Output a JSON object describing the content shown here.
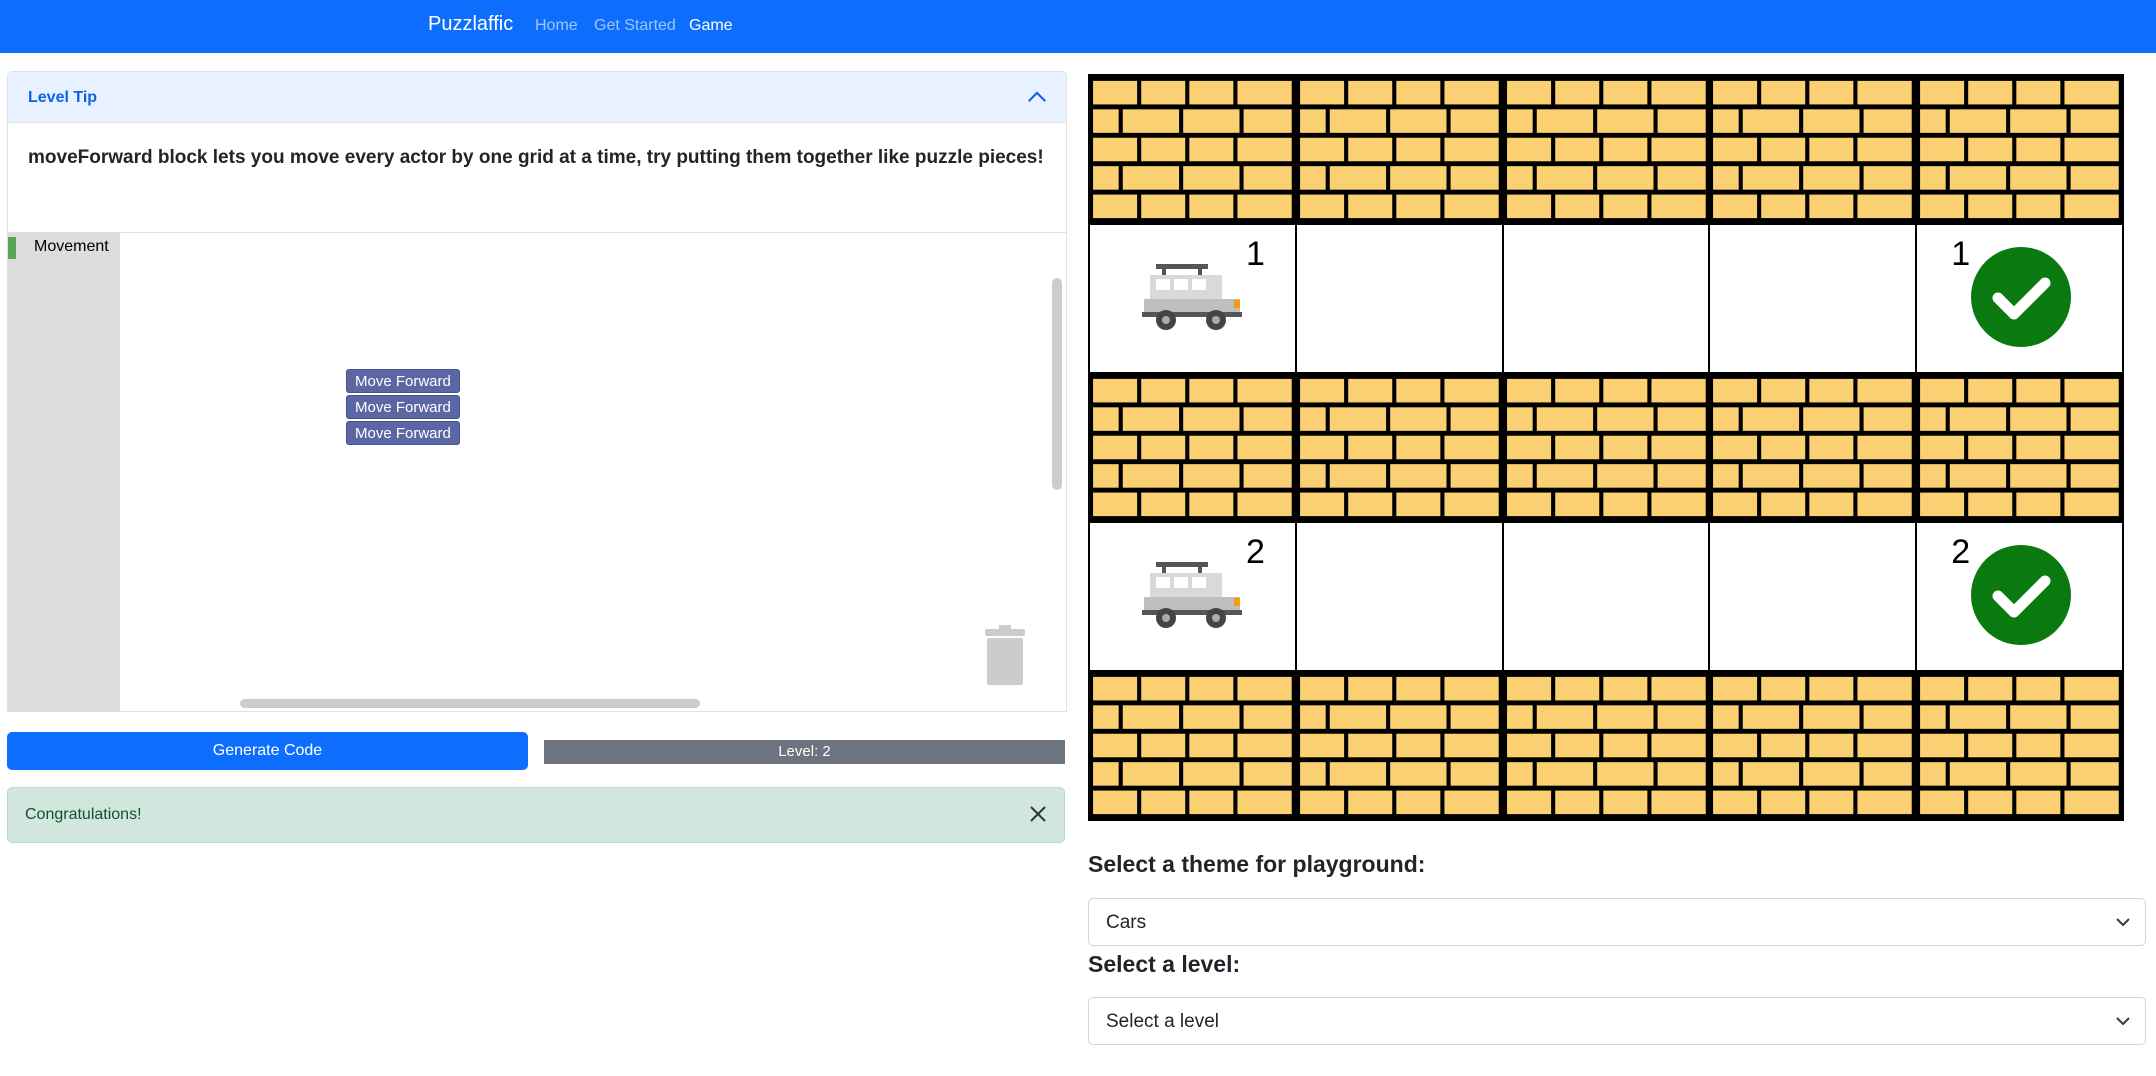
{
  "navbar": {
    "brand": "Puzzlaffic",
    "links": [
      "Home",
      "Get Started",
      "Game"
    ]
  },
  "tip": {
    "title": "Level Tip",
    "text": "moveForward block lets you move every actor by one grid at a time, try putting them together like puzzle pieces!"
  },
  "workspace": {
    "category": "Movement",
    "blocks": [
      "Move Forward",
      "Move Forward",
      "Move Forward"
    ]
  },
  "buttons": {
    "generate": "Generate Code",
    "level": "Level: 2"
  },
  "alert": {
    "text": "Congratulations!"
  },
  "grid": {
    "rows": [
      [
        "wall",
        "wall",
        "wall",
        "wall",
        "wall"
      ],
      [
        "car",
        "empty",
        "empty",
        "empty",
        "goal"
      ],
      [
        "wall",
        "wall",
        "wall",
        "wall",
        "wall"
      ],
      [
        "car",
        "empty",
        "empty",
        "empty",
        "goal"
      ],
      [
        "wall",
        "wall",
        "wall",
        "wall",
        "wall"
      ]
    ],
    "actor_labels": [
      "1",
      "2"
    ],
    "goal_labels": [
      "1",
      "2"
    ]
  },
  "colors": {
    "primary": "#0d6efd",
    "brick": "#fbd072",
    "goal": "#0a7a10",
    "block": "#5b67a5",
    "alert_bg": "#d1e7dd"
  },
  "theme_select": {
    "label": "Select a theme for playground:",
    "value": "Cars"
  },
  "level_select": {
    "label": "Select a level:",
    "value": "Select a level"
  }
}
